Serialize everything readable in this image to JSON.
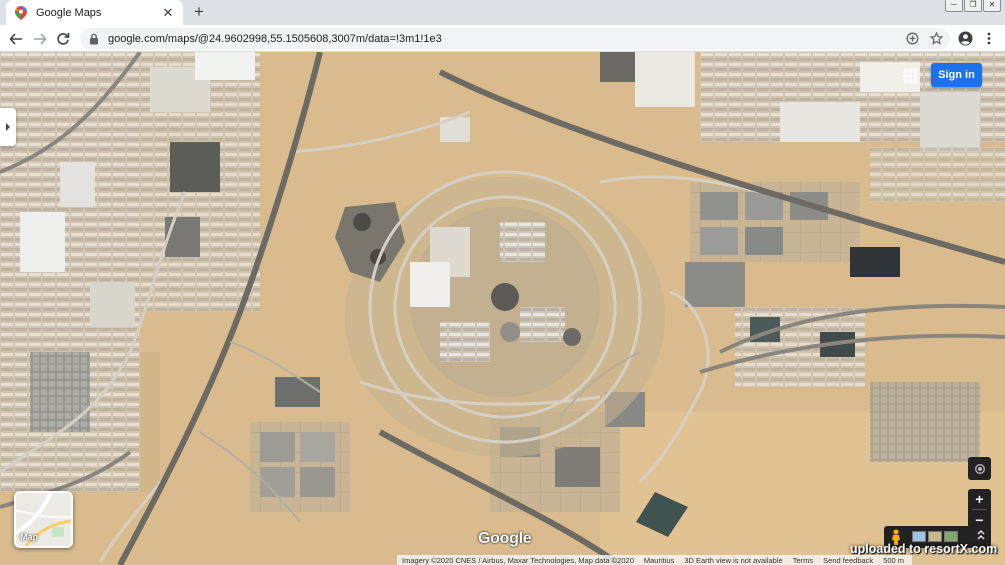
{
  "browser": {
    "tab_title": "Google Maps",
    "tab_close": "✕",
    "new_tab": "+",
    "url": "google.com/maps/@24.9602998,55.1505608,3007m/data=!3m1!1e3",
    "window_controls": [
      "─",
      "❐",
      "✕"
    ]
  },
  "map": {
    "signin_label": "Sign in",
    "layer_label": "Map",
    "google_logo": "Google",
    "zoom_in": "+",
    "zoom_out": "−",
    "watermark": "uploaded to resortX.com",
    "attribution": [
      "Imagery ©2020 CNES / Airbus, Maxar Technologies, Map data ©2020",
      "Mauritius",
      "3D Earth view is not available",
      "Terms",
      "Send feedback",
      "500 m"
    ]
  },
  "colors": {
    "sand": "#d8b98a",
    "accent_blue": "#1a73e8",
    "control_dark": "#222222"
  }
}
